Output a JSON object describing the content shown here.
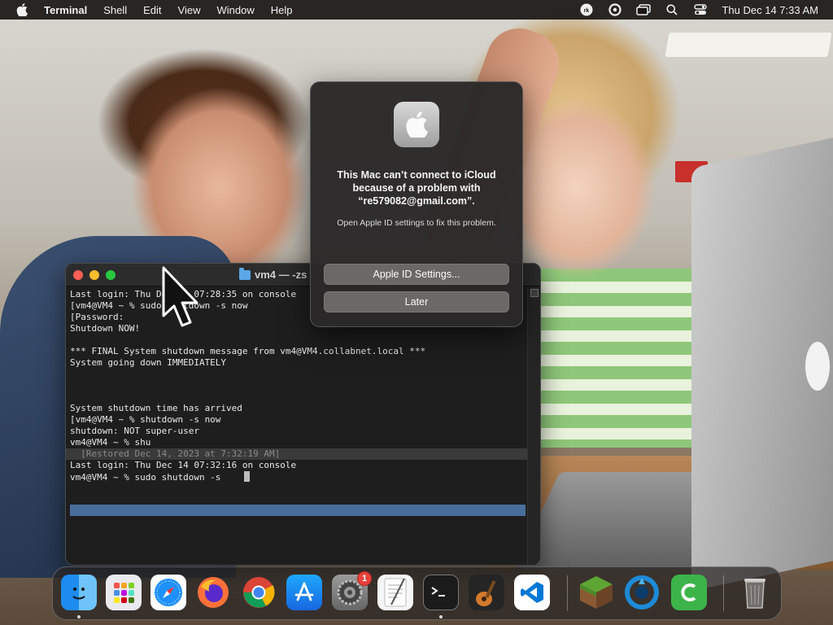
{
  "menubar": {
    "app_name": "Terminal",
    "menus": [
      "Shell",
      "Edit",
      "View",
      "Window",
      "Help"
    ],
    "clock": "Thu Dec 14  7:33 AM",
    "status_icons": [
      "ocr-icon",
      "screen-recorder-icon",
      "display-mirroring-icon",
      "spotlight-icon",
      "control-center-icon"
    ]
  },
  "terminal": {
    "title": "vm4 — -zs",
    "lines": [
      "Last login: Thu Dec 14 07:28:35 on console",
      "[vm4@VM4 ~ % sudo shutdown -s now",
      "[Password:",
      "Shutdown NOW!",
      "",
      "*** FINAL System shutdown message from vm4@VM4.collabnet.local ***",
      "System going down IMMEDIATELY",
      "",
      "",
      "",
      "System shutdown time has arrived",
      "[vm4@VM4 ~ % shutdown -s now",
      "shutdown: NOT super-user",
      "vm4@VM4 ~ % shu",
      "  [Restored Dec 14, 2023 at 7:32:19 AM]",
      "Last login: Thu Dec 14 07:32:16 on console",
      "vm4@VM4 ~ % sudo shutdown -s"
    ]
  },
  "alert": {
    "title": "This Mac can’t connect to iCloud because of a problem with “re579082@gmail.com”.",
    "message": "Open Apple ID settings to fix this problem.",
    "primary_button": "Apple ID Settings...",
    "secondary_button": "Later"
  },
  "dock": {
    "apps": [
      "Finder",
      "Launchpad",
      "Safari",
      "Firefox",
      "Chrome",
      "App Store",
      "System Settings",
      "TextEdit",
      "Terminal",
      "GarageBand",
      "Visual Studio Code",
      "Minecraft",
      "Citrix Workspace",
      "Camtasia",
      "Trash"
    ],
    "settings_badge": "1"
  },
  "colors": {
    "menubar_bg": "#191614",
    "terminal_bg": "#1e1e1e",
    "selection": "#4a6e9c",
    "alert_bg": "#2a2828",
    "button_bg": "#6b6966",
    "close": "#fe5f57",
    "minimize": "#febc2e",
    "zoom": "#28c840",
    "badge": "#e8403a"
  }
}
